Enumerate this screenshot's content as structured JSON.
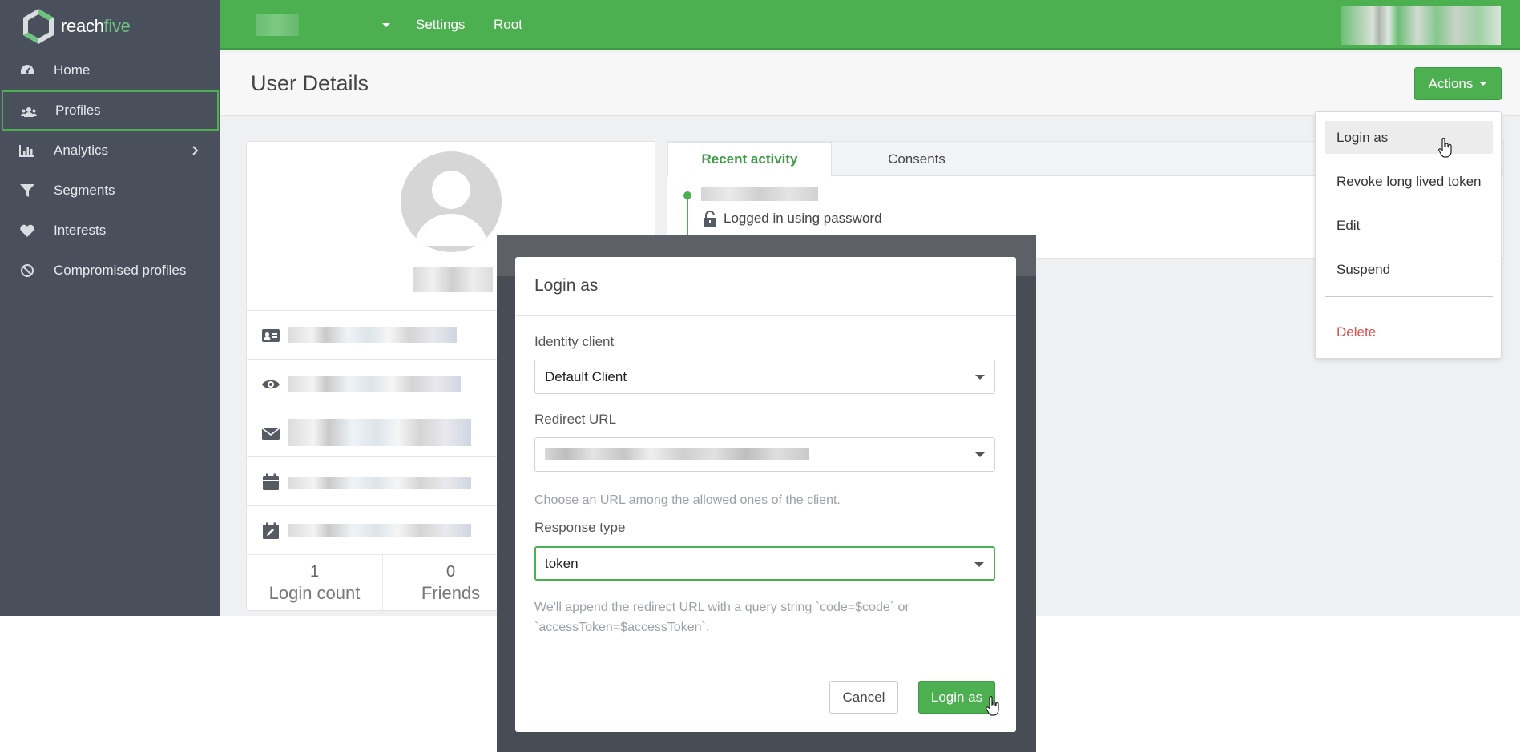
{
  "brand": {
    "name_part1": "reach",
    "name_part2": "five"
  },
  "topbar": {
    "links": [
      "Settings",
      "Root"
    ]
  },
  "sidebar": {
    "items": [
      {
        "label": "Home",
        "icon": "dashboard-icon"
      },
      {
        "label": "Profiles",
        "icon": "users-icon",
        "active": true
      },
      {
        "label": "Analytics",
        "icon": "bar-chart-icon",
        "has_submenu": true
      },
      {
        "label": "Segments",
        "icon": "filter-icon"
      },
      {
        "label": "Interests",
        "icon": "heart-icon"
      },
      {
        "label": "Compromised profiles",
        "icon": "ban-icon"
      }
    ]
  },
  "page": {
    "title": "User Details",
    "actions_label": "Actions"
  },
  "actions_menu": {
    "items": [
      "Login as",
      "Revoke long lived token",
      "Edit",
      "Suspend"
    ],
    "danger_item": "Delete"
  },
  "profile": {
    "info_icons": [
      "id-card-icon",
      "eye-icon",
      "envelope-icon",
      "calendar-icon",
      "calendar-edit-icon"
    ],
    "stats": [
      {
        "value": "1",
        "label": "Login count"
      },
      {
        "value": "0",
        "label": "Friends"
      }
    ]
  },
  "activity": {
    "tabs": [
      "Recent activity",
      "Consents"
    ],
    "entries": [
      {
        "text": "Logged in using password"
      }
    ]
  },
  "modal": {
    "title": "Login as",
    "identity_client": {
      "label": "Identity client",
      "value": "Default Client"
    },
    "redirect_url": {
      "label": "Redirect URL",
      "help": "Choose an URL among the allowed ones of the client."
    },
    "response_type": {
      "label": "Response type",
      "value": "token",
      "help_line1": "We'll append the redirect URL with a query string `code=$code` or",
      "help_line2": "`accessToken=$accessToken`."
    },
    "cancel_label": "Cancel",
    "submit_label": "Login as"
  },
  "colors": {
    "accent": "#4caf50",
    "sidebar": "#4a4f5c",
    "danger": "#d9534f"
  }
}
